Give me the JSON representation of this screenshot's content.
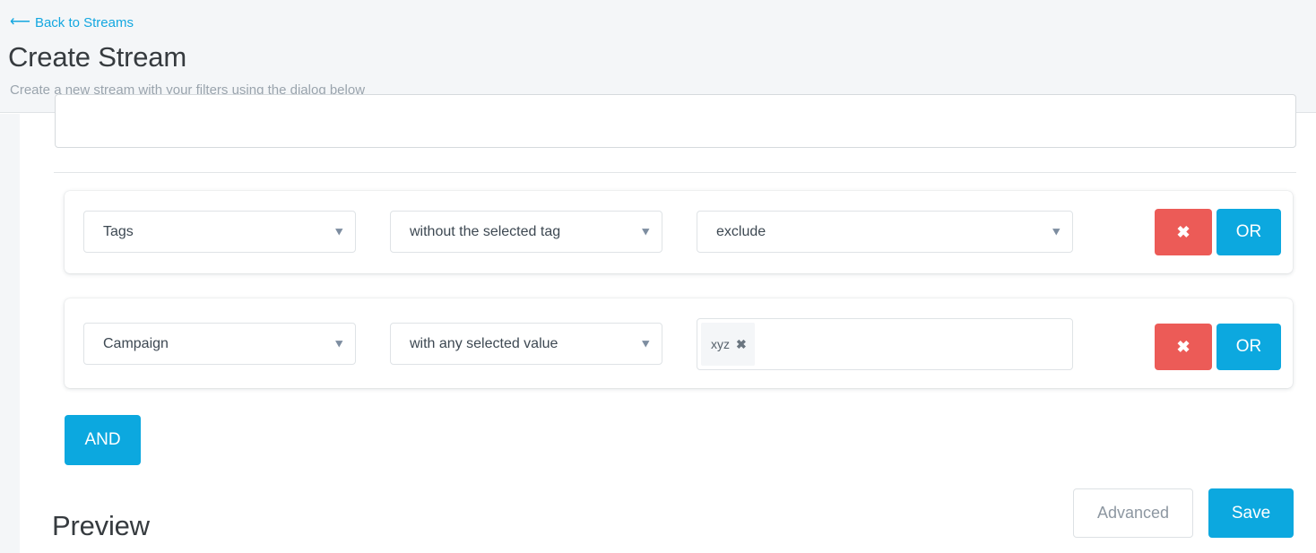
{
  "header": {
    "back_link": "Back to Streams",
    "back_icon": "arrow-left-icon",
    "title": "Create Stream",
    "subtitle": "Create a new stream with your filters using the dialog below"
  },
  "colors": {
    "accent_blue": "#0ca8df",
    "link_blue": "#13a7e0",
    "danger_red": "#ec5b57",
    "header_bg": "#f4f6f8",
    "text_dark": "#363b3f",
    "text_muted": "#9aa4ad"
  },
  "filters": [
    {
      "field": "Tags",
      "operator": "without the selected tag",
      "value_type": "select",
      "value": "exclude",
      "delete_label": "✖",
      "delete_icon": "close-icon",
      "or_label": "OR",
      "chevron_icon": "chevron-down-icon"
    },
    {
      "field": "Campaign",
      "operator": "with any selected value",
      "value_type": "tokens",
      "tokens": [
        {
          "label": "xyz",
          "remove_icon": "close-icon",
          "remove_label": "✖"
        }
      ],
      "delete_label": "✖",
      "delete_icon": "close-icon",
      "or_label": "OR",
      "chevron_icon": "chevron-down-icon"
    }
  ],
  "buttons": {
    "and": "AND",
    "advanced": "Advanced",
    "save": "Save"
  },
  "preview": {
    "title": "Preview"
  },
  "icons": {
    "chevron_down": "▾",
    "arrow_left": "←"
  }
}
